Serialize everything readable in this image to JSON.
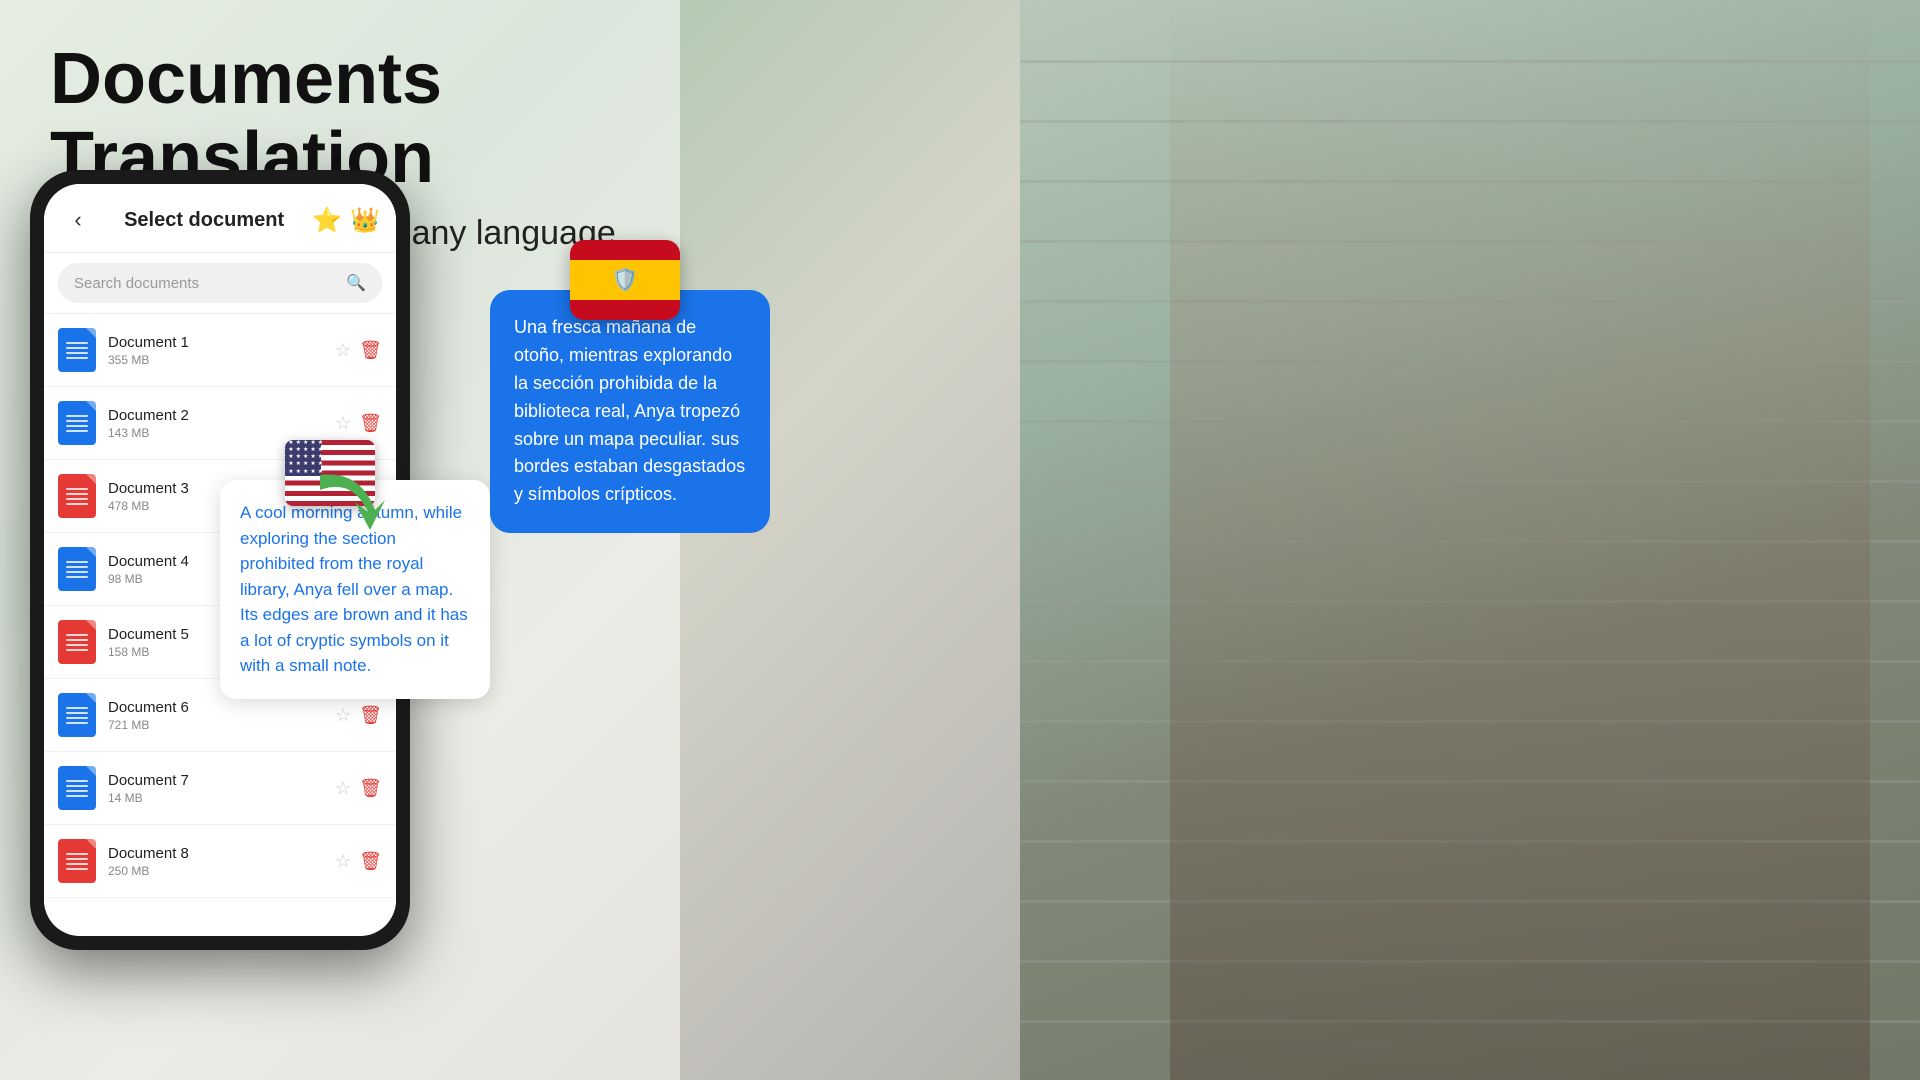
{
  "page": {
    "title": "Documents Translation",
    "subtitle": "Translate documents in any language"
  },
  "phone": {
    "back_label": "‹",
    "header_title": "Select document",
    "star1": "⭐",
    "star2": "👑",
    "search_placeholder": "Search documents"
  },
  "documents": [
    {
      "name": "Document 1",
      "size": "355 MB",
      "color": "blue"
    },
    {
      "name": "Document 2",
      "size": "143 MB",
      "color": "blue"
    },
    {
      "name": "Document 3",
      "size": "478 MB",
      "color": "red"
    },
    {
      "name": "Document 4",
      "size": "98 MB",
      "color": "blue"
    },
    {
      "name": "Document 5",
      "size": "158 MB",
      "color": "red"
    },
    {
      "name": "Document 6",
      "size": "721 MB",
      "color": "blue"
    },
    {
      "name": "Document 7",
      "size": "14 MB",
      "color": "blue"
    },
    {
      "name": "Document 8",
      "size": "250 MB",
      "color": "red"
    }
  ],
  "english_bubble": {
    "text": "A cool morning autumn, while exploring the section prohibited from the royal library, Anya fell over a map. Its edges are brown and it has a lot of cryptic symbols on it with a small note."
  },
  "spanish_bubble": {
    "text": "Una fresca mañana de otoño, mientras explorando la sección prohibida de la biblioteca real, Anya tropezó sobre un mapa peculiar. sus bordes estaban desgastados y símbolos crípticos."
  },
  "colors": {
    "accent_blue": "#1a73e8",
    "bubble_bg": "#1a73e8",
    "english_text": "#1a73e8"
  }
}
